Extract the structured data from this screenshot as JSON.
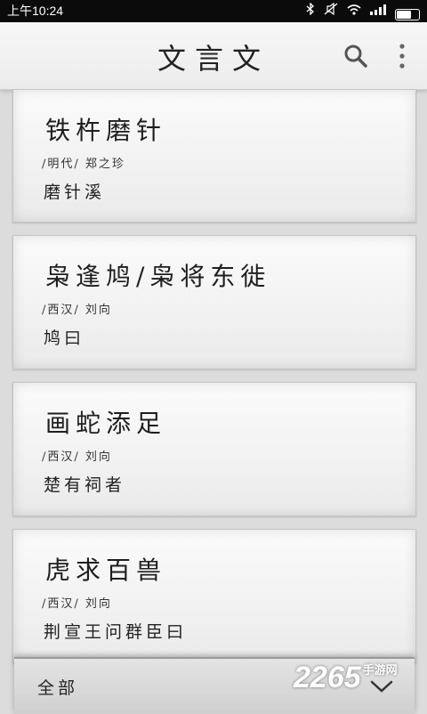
{
  "status_bar": {
    "time": "上午10:24",
    "icons": [
      "bluetooth-icon",
      "silent-icon",
      "wifi-icon",
      "signal-icon",
      "battery-icon"
    ]
  },
  "app_bar": {
    "title": "文言文",
    "search_icon": "search-icon",
    "more_icon": "more-vert-icon"
  },
  "articles": [
    {
      "title": "铁杵磨针",
      "meta": "/明代/ 郑之珍",
      "snippet": "磨针溪"
    },
    {
      "title": "枭逢鸠/枭将东徙",
      "meta": "/西汉/ 刘向",
      "snippet": "鸠曰"
    },
    {
      "title": "画蛇添足",
      "meta": "/西汉/ 刘向",
      "snippet": "楚有祠者"
    },
    {
      "title": "虎求百兽",
      "meta": "/西汉/ 刘向",
      "snippet": "荆宣王问群臣曰"
    }
  ],
  "filter": {
    "label": "全部",
    "chevron_icon": "chevron-down-icon"
  },
  "watermark": {
    "main": "2265",
    "sub": "手游网"
  }
}
